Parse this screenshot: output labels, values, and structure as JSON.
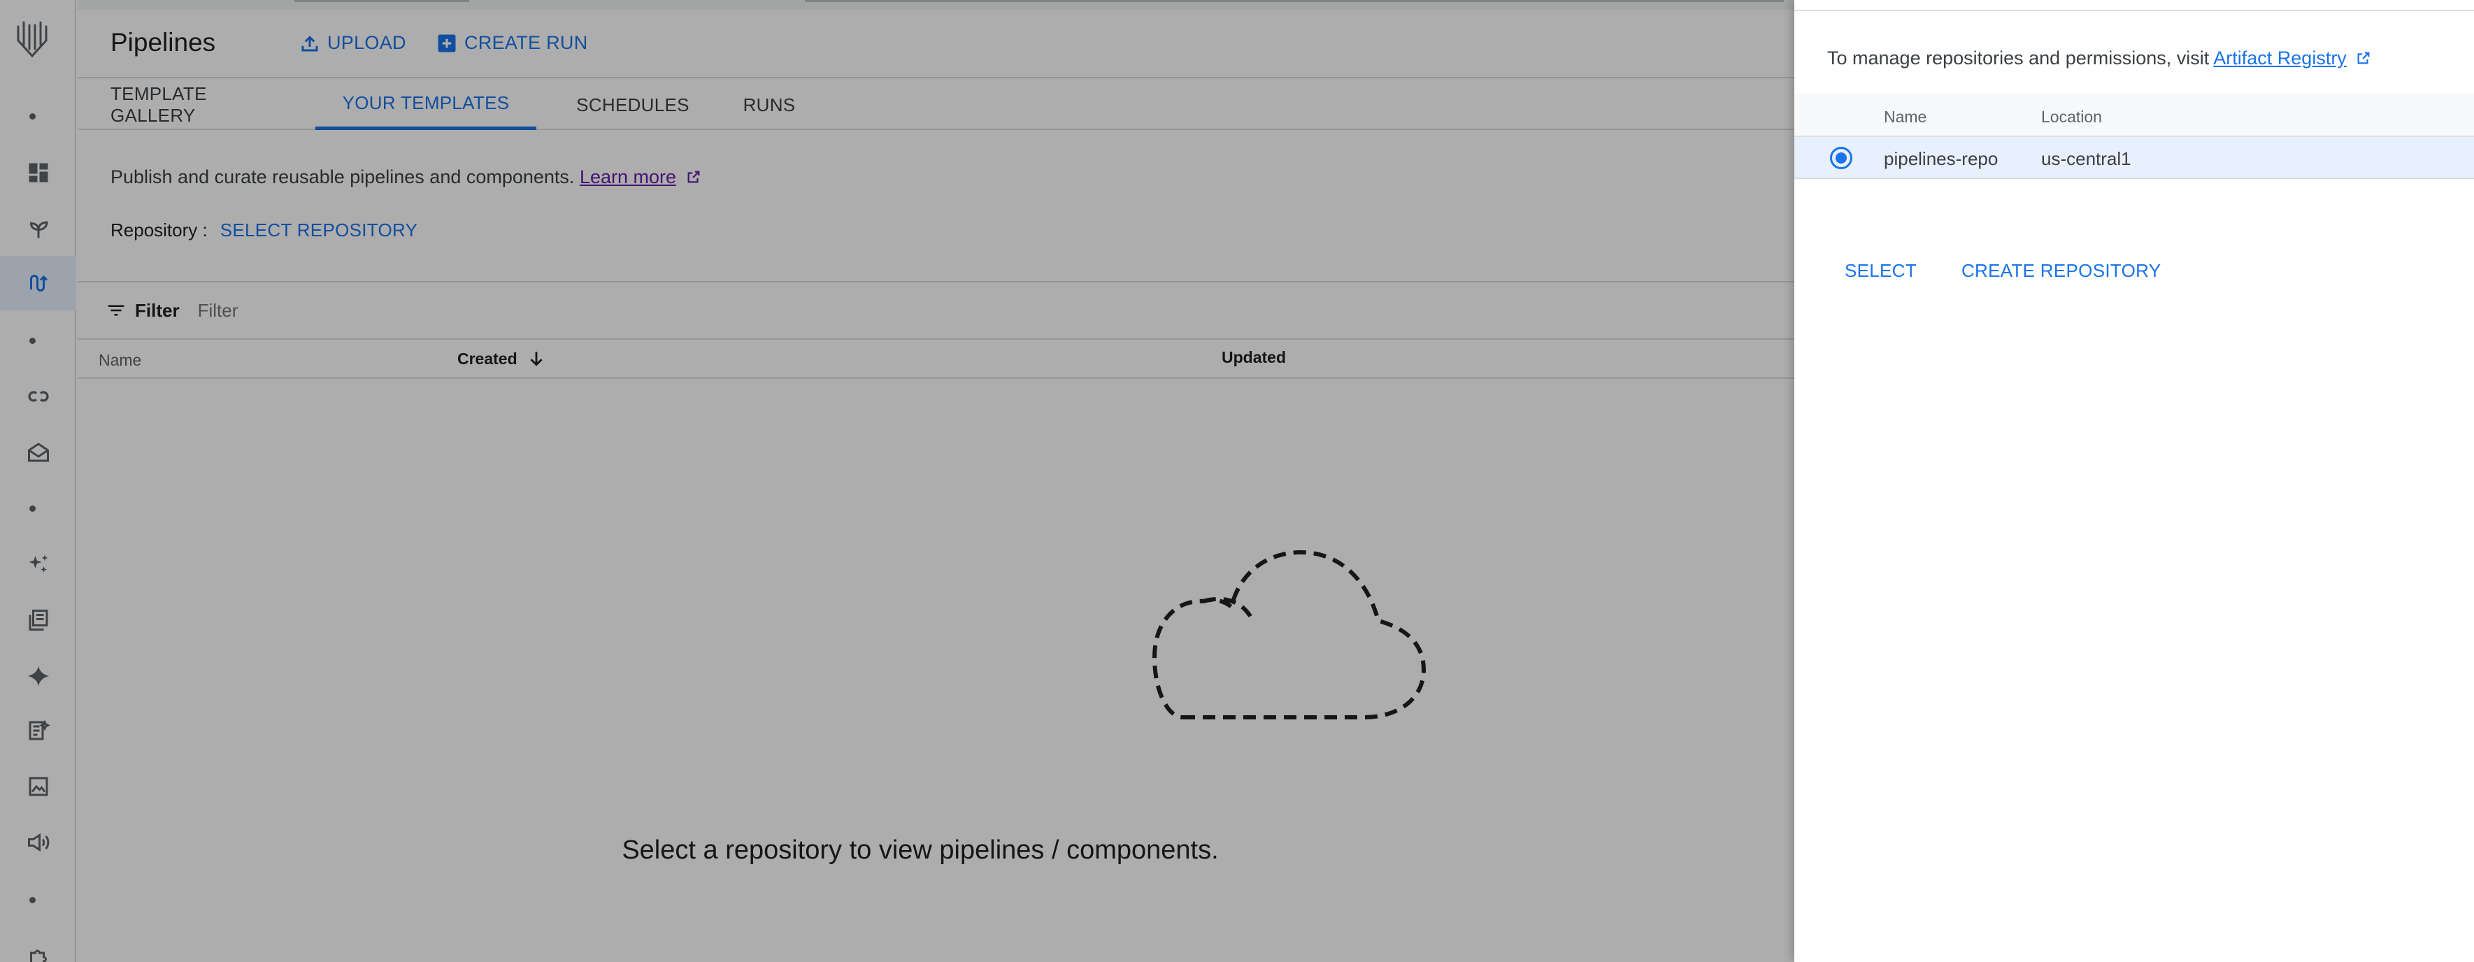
{
  "header": {
    "title": "Pipelines",
    "upload_label": "UPLOAD",
    "create_run_label": "CREATE RUN"
  },
  "tabs": [
    {
      "label": "TEMPLATE GALLERY",
      "active": false
    },
    {
      "label": "YOUR TEMPLATES",
      "active": true
    },
    {
      "label": "SCHEDULES",
      "active": false
    },
    {
      "label": "RUNS",
      "active": false
    }
  ],
  "intro": {
    "text": "Publish and curate reusable pipelines and components.",
    "learn_more": "Learn more"
  },
  "repository": {
    "label": "Repository :",
    "select_label": "SELECT REPOSITORY"
  },
  "filter": {
    "label": "Filter",
    "placeholder": "Filter"
  },
  "table": {
    "columns": [
      "Name",
      "Created",
      "Updated"
    ],
    "sorted_column": "Created",
    "sort_direction": "descending"
  },
  "empty_state": {
    "message": "Select a repository to view pipelines / components."
  },
  "panel": {
    "info_text": "To manage repositories and permissions, visit",
    "info_link": "Artifact Registry",
    "columns": [
      "Name",
      "Location"
    ],
    "rows": [
      {
        "name": "pipelines-repo",
        "location": "us-central1",
        "selected": true
      }
    ],
    "select_label": "SELECT",
    "create_label": "CREATE REPOSITORY"
  },
  "rail_icons": [
    "vertex-ai-logo",
    "dashboard-icon",
    "model-garden-icon",
    "pipelines-icon",
    "colab-icon",
    "workbench-icon",
    "generative-ai-icon",
    "library-icon",
    "sparkle-icon",
    "prompt-icon",
    "vision-icon",
    "speech-icon",
    "extensions-icon"
  ],
  "colors": {
    "accent": "#1a73e8",
    "selected_row": "#e8f0fe",
    "scrim": "rgba(0,0,0,0.32)"
  }
}
